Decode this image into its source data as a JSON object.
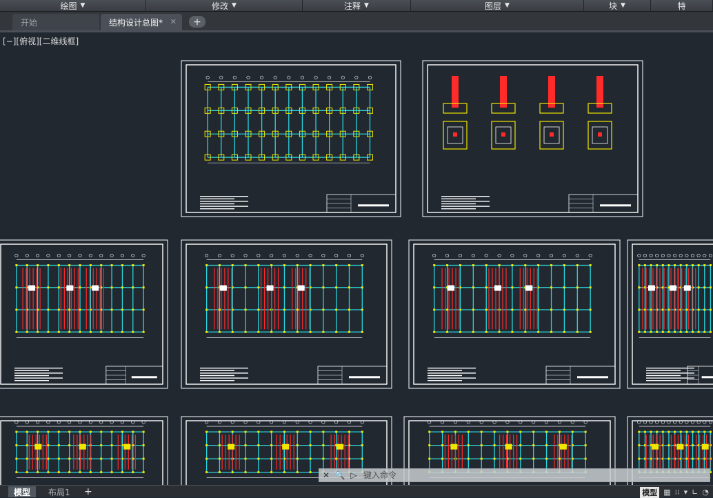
{
  "ribbon": {
    "panels": [
      {
        "label": "绘图"
      },
      {
        "label": "修改"
      },
      {
        "label": "注释"
      },
      {
        "label": "图层"
      },
      {
        "label": "块"
      },
      {
        "label": "特"
      }
    ]
  },
  "tabs": {
    "start": "开始",
    "active": "结构设计总图*",
    "close_glyph": "✕",
    "new_glyph": "+"
  },
  "viewport": {
    "label": "[−][俯视][二维线框]"
  },
  "command": {
    "placeholder": "键入命令"
  },
  "status": {
    "model_tab": "模型",
    "layout_tab": "布局1",
    "add": "+",
    "mode": "模型"
  },
  "icons": {
    "dropdown": "chevron-down-icon",
    "close": "close-icon",
    "search": "search-icon",
    "grid": "grid-icon",
    "snap": "snap-icon"
  },
  "colors": {
    "canvas": "#212830",
    "sheet_border": "#ffffff",
    "grid_lines": "#27d7e0",
    "columns": "#f2e600",
    "rebar": "#ff2a2a"
  }
}
